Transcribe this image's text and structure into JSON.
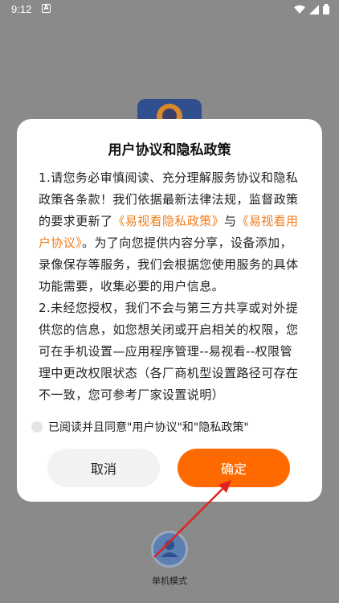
{
  "status_bar": {
    "time": "9:12",
    "notification_letter": "A"
  },
  "dialog": {
    "title": "用户协议和隐私政策",
    "body": {
      "p1_a": "1.请您务必审慎阅读、充分理解服务协议和隐私政策各条款！我们依据最新法律法规，监督政策的要求更新了",
      "link_privacy": "《易视看隐私政策》",
      "p1_and": "与",
      "link_user": "《易视看用户协议》",
      "p1_b": "。为了向您提供内容分享，设备添加，录像保存等服务，我们会根据您使用服务的具体功能需要，收集必要的用户信息。",
      "p2": "2.未经您授权，我们不会与第三方共享或对外提供您的信息，如您想关闭或开启相关的权限，您可在手机设置—应用程序管理--易视看--权限管理中更改权限状态（各厂商机型设置路径可存在不一致，您可参考厂家设置说明）"
    },
    "agree_text": "已阅读并且同意\"用户协议\"和\"隐私政策\"",
    "agree_checked": false,
    "cancel_label": "取消",
    "confirm_label": "确定"
  },
  "bottom": {
    "standalone_label": "单机模式"
  },
  "colors": {
    "accent": "#ff6a00",
    "link": "#f07d1b",
    "overlay": "#8a8a8a"
  }
}
